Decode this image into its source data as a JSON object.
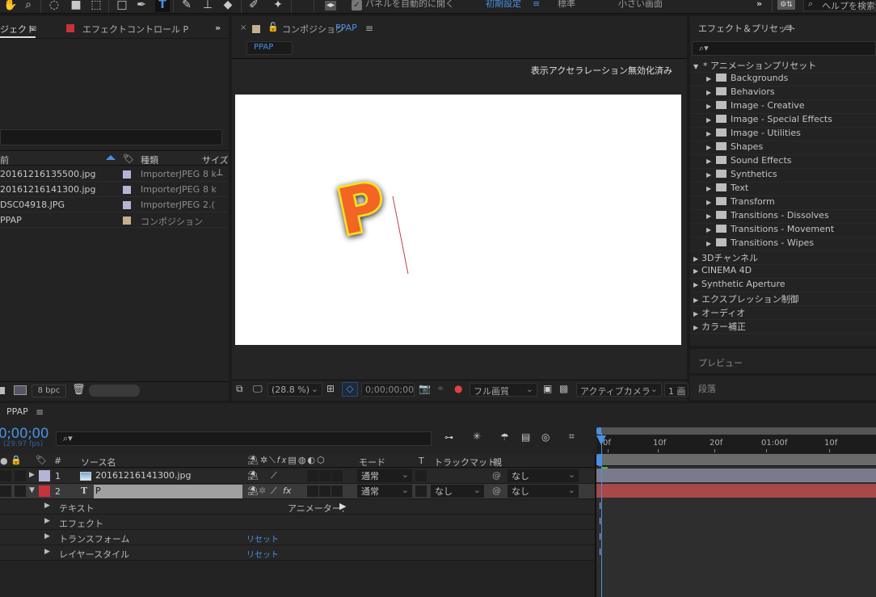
{
  "toolbar": {
    "tools": [
      {
        "name": "hand-tool",
        "glyph": "✋"
      },
      {
        "name": "zoom-tool",
        "glyph": "⌕"
      },
      {
        "name": "rotate-tool",
        "glyph": "◌"
      },
      {
        "name": "camera-tool",
        "glyph": "■"
      },
      {
        "name": "pan-behind-tool",
        "glyph": "⬚"
      },
      {
        "name": "rectangle-tool",
        "glyph": "□"
      },
      {
        "name": "pen-tool",
        "glyph": "✒"
      },
      {
        "name": "type-tool",
        "glyph": "T"
      },
      {
        "name": "brush-tool",
        "glyph": "✎"
      },
      {
        "name": "clone-stamp-tool",
        "glyph": "⊥"
      },
      {
        "name": "eraser-tool",
        "glyph": "◆"
      },
      {
        "name": "roto-brush-tool",
        "glyph": "✐"
      },
      {
        "name": "puppet-pin-tool",
        "glyph": "✦"
      }
    ],
    "auto_open_panels_label": "パネルを自動的に開く",
    "auto_open_panels_checked": true,
    "workspaces": [
      "初期設定",
      "標準",
      "小さい画面"
    ],
    "active_workspace": "初期設定",
    "more_label": "»",
    "help_search_placeholder": "ヘルプを検索"
  },
  "project_panel": {
    "tab_label": "ジェクト",
    "effect_controls_tab": "エフェクトコントロール P",
    "overflow_label": "»",
    "columns": {
      "name": "前",
      "type": "種類",
      "size": "サイズ"
    },
    "items": [
      {
        "name": "20161216135500.jpg",
        "label_color": "#b4b4d6",
        "type": "ImporterJPEG",
        "size": "8 k"
      },
      {
        "name": "20161216141300.jpg",
        "label_color": "#b4b4d6",
        "type": "ImporterJPEG",
        "size": "8 k"
      },
      {
        "name": "DSC04918.JPG",
        "label_color": "#b4b4d6",
        "type": "ImporterJPEG",
        "size": "2.("
      },
      {
        "name": "PPAP",
        "label_color": "#c4b090",
        "type": "コンポジション",
        "size": ""
      }
    ],
    "bit_depth": "8 bpc"
  },
  "composition_panel": {
    "close_label": "×",
    "label_color": "#c4b090",
    "tab_prefix": "コンポジション",
    "tab_name": "PPAP",
    "sub_tab": "PPAP",
    "notice": "表示アクセラレーション無効化済み",
    "canvas_letter": "P",
    "footer": {
      "zoom": "(28.8 %)",
      "timecode": "0;00;00;00",
      "quality": "フル画質",
      "camera": "アクティブカメラ",
      "views": "1 画"
    }
  },
  "effects_panel": {
    "title": "エフェクト＆プリセット",
    "search_placeholder": "",
    "root": "* アニメーションプリセット",
    "preset_folders": [
      "Backgrounds",
      "Behaviors",
      "Image - Creative",
      "Image - Special Effects",
      "Image - Utilities",
      "Shapes",
      "Sound Effects",
      "Synthetics",
      "Text",
      "Transform",
      "Transitions - Dissolves",
      "Transitions - Movement",
      "Transitions - Wipes"
    ],
    "categories": [
      "3Dチャンネル",
      "CINEMA 4D",
      "Synthetic Aperture",
      "エクスプレッション制御",
      "オーディオ",
      "カラー補正"
    ],
    "preview_label": "プレビュー",
    "paragraph_label": "段落"
  },
  "timeline": {
    "comp_name": "PPAP",
    "timecode": "0;00;00",
    "fps": "(29.97 fps)",
    "columns": {
      "num": "#",
      "source": "ソース名",
      "mode": "モード",
      "t": "T",
      "track_matte": "トラックマット",
      "parent": "親"
    },
    "ruler_ticks": [
      "0f",
      "10f",
      "20f",
      "01:00f",
      "10f"
    ],
    "layers": [
      {
        "index": "1",
        "name": "20161216141300.jpg",
        "type": "image",
        "label_color": "#b4b4d6",
        "mode": "通常",
        "track_matte": "",
        "parent": "なし",
        "expanded": false,
        "selected": false,
        "bar_color": "#7a7a8c"
      },
      {
        "index": "2",
        "name": "P",
        "type": "text",
        "label_color": "#c8323a",
        "mode": "通常",
        "track_matte": "なし",
        "parent": "なし",
        "expanded": true,
        "selected": true,
        "bar_color": "#a84848"
      }
    ],
    "properties": [
      {
        "label": "テキスト",
        "extra": "アニメーター：",
        "extra_type": "animator"
      },
      {
        "label": "エフェクト",
        "extra": "",
        "extra_type": ""
      },
      {
        "label": "トランスフォーム",
        "extra": "リセット",
        "extra_type": "link"
      },
      {
        "label": "レイヤースタイル",
        "extra": "リセット",
        "extra_type": "link"
      }
    ]
  },
  "colors": {
    "accent": "#4a90e2",
    "panel_bg": "#232323",
    "canvas_bg": "#ffffff"
  }
}
